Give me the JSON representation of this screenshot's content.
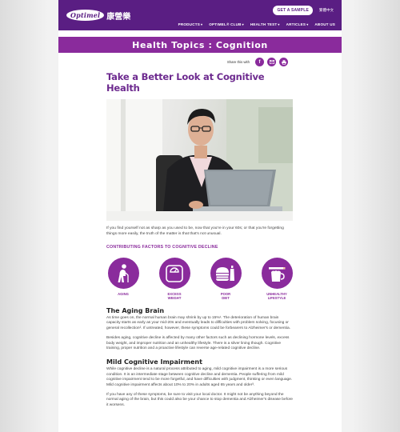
{
  "header": {
    "logo_text": "Optimel",
    "logo_cn": "康營樂",
    "sample_button": "GET A SAMPLE",
    "language": "繁體中文",
    "nav": [
      {
        "label": "PRODUCTS",
        "has_dropdown": true
      },
      {
        "label": "OPTIMEL® CLUB",
        "has_dropdown": true
      },
      {
        "label": "HEALTH TEST",
        "has_dropdown": true
      },
      {
        "label": "ARTICLES",
        "has_dropdown": true
      },
      {
        "label": "ABOUT US",
        "has_dropdown": false
      }
    ]
  },
  "banner": {
    "title": "Health Topics : Cognition"
  },
  "share": {
    "label": "Share this with"
  },
  "article": {
    "title": "Take a Better Look at Cognitive Health",
    "intro": "If you find yourself not as sharp as you used to be, now that you're in your 60s; or that you're forgetting things more easily, the truth of the matter is that that's not unusual.",
    "factors_heading": "CONTRIBUTING FACTORS TO COGNITIVE DECLINE",
    "factors": [
      {
        "label": "AGING",
        "icon": "elderly-person-icon"
      },
      {
        "label": "EXCESS\nWEIGHT",
        "icon": "weighing-scale-icon"
      },
      {
        "label": "POOR\nDIET",
        "icon": "junk-food-icon"
      },
      {
        "label": "UNHEALTHY\nLIFESTYLE",
        "icon": "cigarette-beer-icon"
      }
    ],
    "section1_title": "The Aging Brain",
    "section1_p1": "As time goes on, the normal human brain may shrink by up to 15%¹. The deterioration of human brain capacity starts as early as your mid-20s and eventually leads to difficulties with problem solving, focusing or general recollection². If untreated, however, these symptoms could be forbearers to Alzheimer's or dementia.",
    "section1_p2": "Besides aging, cognitive decline is affected by many other factors such as declining hormone levels, excess body weight, and improper nutrition and an unhealthy lifestyle. There is a silver lining though. Cognitive training, proper nutrition and a proactive lifestyle can reverse age-related cognitive decline.",
    "section2_title": "Mild Cognitive Impairment",
    "section2_p1": "While cognitive decline is a natural process attributed to aging, mild cognitive impairment is a more serious condition. It is an intermediate stage between cognitive decline and dementia. People suffering from mild cognitive impairment tend to be more forgetful, and have difficulties with judgment, thinking or even language. Mild cognitive impairment affects about 10% to 20% in adults aged 65 years and older³.",
    "section2_p2": "If you have any of these symptoms, be sure to visit your local doctor. It might not be anything beyond the normal aging of the brain, but this could also be your chance to stop dementia and Alzheimer's disease before it worsens."
  },
  "colors": {
    "brand_purple": "#5a1e83",
    "accent_magenta": "#8a2b9c",
    "title_purple": "#6d2a8f"
  }
}
